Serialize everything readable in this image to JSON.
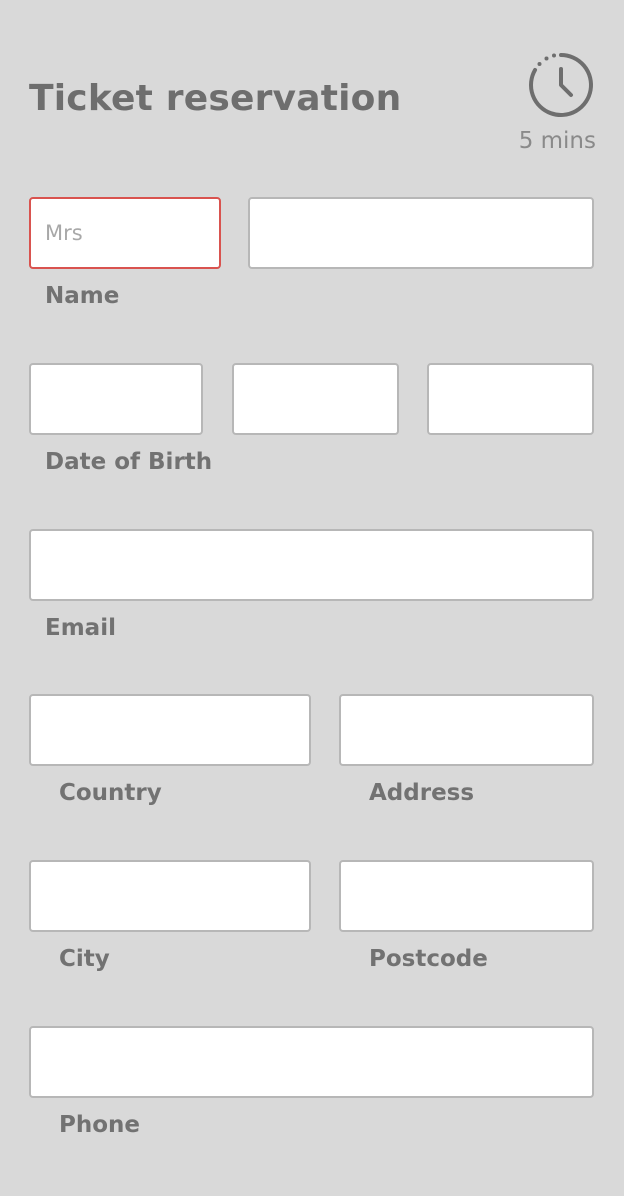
{
  "header": {
    "title": "Ticket reservation",
    "timer_icon": "clock-icon",
    "timer_text": "5 mins"
  },
  "form": {
    "name": {
      "title_placeholder": "Mrs",
      "name_value": "",
      "label": "Name"
    },
    "dob": {
      "label": "Date of Birth"
    },
    "email": {
      "label": "Email"
    },
    "country": {
      "label": "Country"
    },
    "address": {
      "label": "Address"
    },
    "city": {
      "label": "City"
    },
    "postcode": {
      "label": "Postcode"
    },
    "phone": {
      "label": "Phone"
    }
  },
  "colors": {
    "background": "#d9d9d9",
    "error_border": "#d9534f",
    "field_border": "#b7b7b7"
  }
}
